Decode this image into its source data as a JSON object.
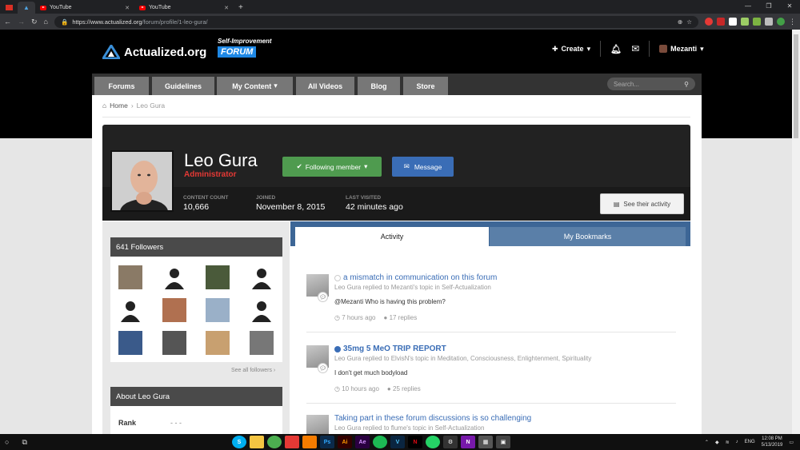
{
  "browser": {
    "tabs": [
      {
        "title": ""
      },
      {
        "title": ""
      },
      {
        "title": "YouTube"
      },
      {
        "title": "YouTube"
      }
    ],
    "url_host": "https://www.actualized.org",
    "url_path": "/forum/profile/1-leo-gura/"
  },
  "site": {
    "logo_text": "Actualized.org",
    "forum_subtitle": "Self-Improvement",
    "forum_label": "FORUM",
    "create_label": "Create",
    "username": "Mezanti"
  },
  "nav": {
    "items": [
      "Forums",
      "Guidelines",
      "My Content",
      "All Videos",
      "Blog",
      "Store"
    ],
    "search_placeholder": "Search..."
  },
  "breadcrumb": {
    "home": "Home",
    "current": "Leo Gura"
  },
  "profile": {
    "name": "Leo Gura",
    "role": "Administrator",
    "follow_label": "Following member",
    "message_label": "Message",
    "stats": [
      {
        "label": "CONTENT COUNT",
        "value": "10,666"
      },
      {
        "label": "JOINED",
        "value": "November 8, 2015"
      },
      {
        "label": "LAST VISITED",
        "value": "42 minutes ago"
      }
    ],
    "activity_button": "See their activity"
  },
  "sidebar": {
    "followers_title": "641 Followers",
    "see_all": "See all followers",
    "about_title": "About Leo Gura",
    "rank_label": "Rank",
    "rank_value": "- - -"
  },
  "tabs": {
    "activity": "Activity",
    "bookmarks": "My Bookmarks"
  },
  "activity": [
    {
      "title": "a mismatch in communication on this forum",
      "meta": "Leo Gura replied to Mezanti's topic in Self-Actualization",
      "body": "@Mezanti Who is having this problem?",
      "time": "7 hours ago",
      "replies": "17 replies"
    },
    {
      "title": "35mg 5 MeO TRIP REPORT",
      "meta": "Leo Gura replied to ElvisN's topic in Meditation, Consciousness, Enlightenment, Spirituality",
      "body": "I don't get much bodyload",
      "time": "10 hours ago",
      "replies": "25 replies"
    },
    {
      "title": "Taking part in these forum discussions is so challenging",
      "meta": "Leo Gura replied to flume's topic in Self-Actualization"
    }
  ],
  "taskbar": {
    "lang": "ENG",
    "time": "12:08 PM",
    "date": "5/13/2019"
  }
}
